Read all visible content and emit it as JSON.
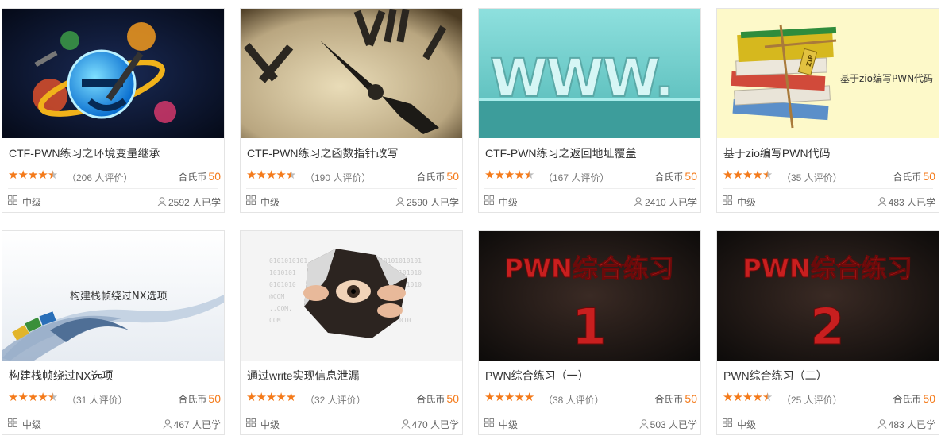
{
  "colors": {
    "accent": "#f47a1a",
    "star_empty": "#bbbbbb",
    "border": "#e4e4e4"
  },
  "courses": [
    {
      "title": "CTF-PWN练习之环境变量继承",
      "rating": 4.5,
      "reviews": "（206 人评价）",
      "price_label": "合氏币",
      "price": "50",
      "level": "中级",
      "learners": "2592 人已学",
      "thumb": "ie-logo"
    },
    {
      "title": "CTF-PWN练习之函数指针改写",
      "rating": 4.5,
      "reviews": "（190 人评价）",
      "price_label": "合氏币",
      "price": "50",
      "level": "中级",
      "learners": "2590 人已学",
      "thumb": "clock"
    },
    {
      "title": "CTF-PWN练习之返回地址覆盖",
      "rating": 4.5,
      "reviews": "（167 人评价）",
      "price_label": "合氏币",
      "price": "50",
      "level": "中级",
      "learners": "2410 人已学",
      "thumb": "www"
    },
    {
      "title": "基于zio编写PWN代码",
      "rating": 4.5,
      "reviews": "（35 人评价）",
      "price_label": "合氏币",
      "price": "50",
      "level": "中级",
      "learners": "483 人已学",
      "thumb": "zip-books",
      "thumb_text": "基于zio编写PWN代码"
    },
    {
      "title": "构建栈帧绕过NX选项",
      "rating": 4.5,
      "reviews": "（31 人评价）",
      "price_label": "合氏币",
      "price": "50",
      "level": "中级",
      "learners": "467 人已学",
      "thumb": "swirl",
      "thumb_text": "构建栈帧绕过NX选项"
    },
    {
      "title": "通过write实现信息泄漏",
      "rating": 5,
      "reviews": "（32 人评价）",
      "price_label": "合氏币",
      "price": "50",
      "level": "中级",
      "learners": "470 人已学",
      "thumb": "eye-paper"
    },
    {
      "title": "PWN综合练习（一）",
      "rating": 5,
      "reviews": "（38 人评价）",
      "price_label": "合氏币",
      "price": "50",
      "level": "中级",
      "learners": "503 人已学",
      "thumb": "pwn-1",
      "thumb_text": "PWN综合练习",
      "thumb_num": "1"
    },
    {
      "title": "PWN综合练习（二）",
      "rating": 4.5,
      "reviews": "（25 人评价）",
      "price_label": "合氏币",
      "price": "50",
      "level": "中级",
      "learners": "483 人已学",
      "thumb": "pwn-2",
      "thumb_text": "PWN综合练习",
      "thumb_num": "2"
    }
  ]
}
